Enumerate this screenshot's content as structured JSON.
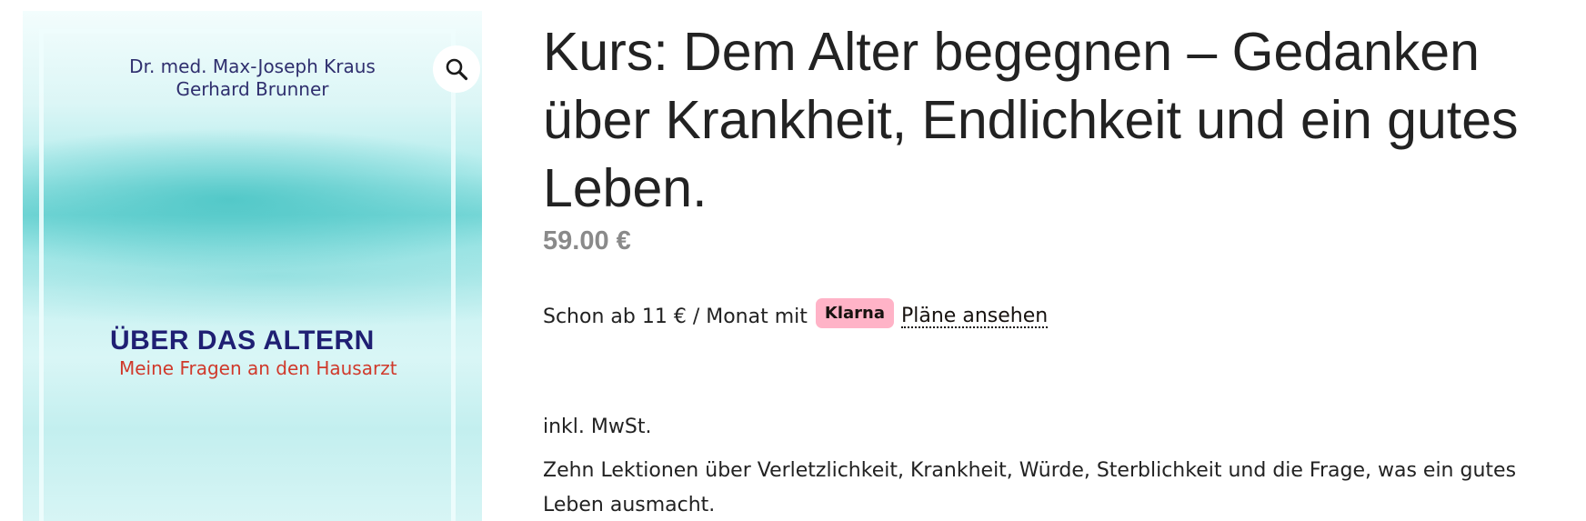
{
  "cover": {
    "authors": [
      "Dr. med. Max-Joseph Kraus",
      "Gerhard Brunner"
    ],
    "title": "ÜBER DAS ALTERN",
    "subtitle": "Meine Fragen an den Hausarzt",
    "zoom_icon": "magnifier-icon"
  },
  "product": {
    "title": "Kurs: Dem Alter begegnen – Gedanken über Krankheit, Endlichkeit und ein gutes Leben.",
    "price": "59.00 €",
    "klarna": {
      "prefix": "Schon ab 11 € / Monat mit",
      "badge": "Klarna",
      "link": "Pläne ansehen",
      "badge_color": "#ffb3c7"
    },
    "tax_note": "inkl. MwSt.",
    "short_description": "Zehn Lektionen über Verletzlichkeit, Krankheit, Würde, Sterblichkeit und die Frage, was ein gutes Leben ausmacht."
  },
  "colors": {
    "price": "#8a8a8a",
    "cover_title": "#1f1f73",
    "cover_subtitle": "#d0392b",
    "cover_teal": "#7cd9d9"
  }
}
